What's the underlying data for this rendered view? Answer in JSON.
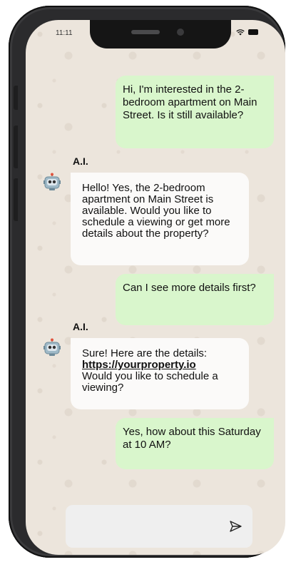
{
  "status": {
    "time": "11:11"
  },
  "messages": [
    {
      "type": "outgoing",
      "text": "Hi, I'm interested in the 2-bedroom apartment on Main Street. Is it still available?"
    },
    {
      "type": "incoming",
      "sender": "A.I.",
      "text": "Hello! Yes, the 2-bedroom apartment on Main Street is available. Would you like to schedule a viewing or get more details about the property?"
    },
    {
      "type": "outgoing",
      "text": "Can I see more details first?"
    },
    {
      "type": "incoming",
      "sender": "A.I.",
      "text_before": "Sure! Here are the details:",
      "link": "https://yourproperty.io",
      "text_after": "Would you like to schedule a viewing?"
    },
    {
      "type": "outgoing",
      "text": "Yes, how about this Saturday at 10 AM?"
    }
  ],
  "composer": {
    "value": "",
    "send_icon": "send-icon"
  },
  "colors": {
    "outgoing_bubble": "#d9f6cc",
    "incoming_bubble": "#fbfaf9",
    "chat_background": "#ece5dc",
    "phone_frame": "#2b2b2d"
  }
}
